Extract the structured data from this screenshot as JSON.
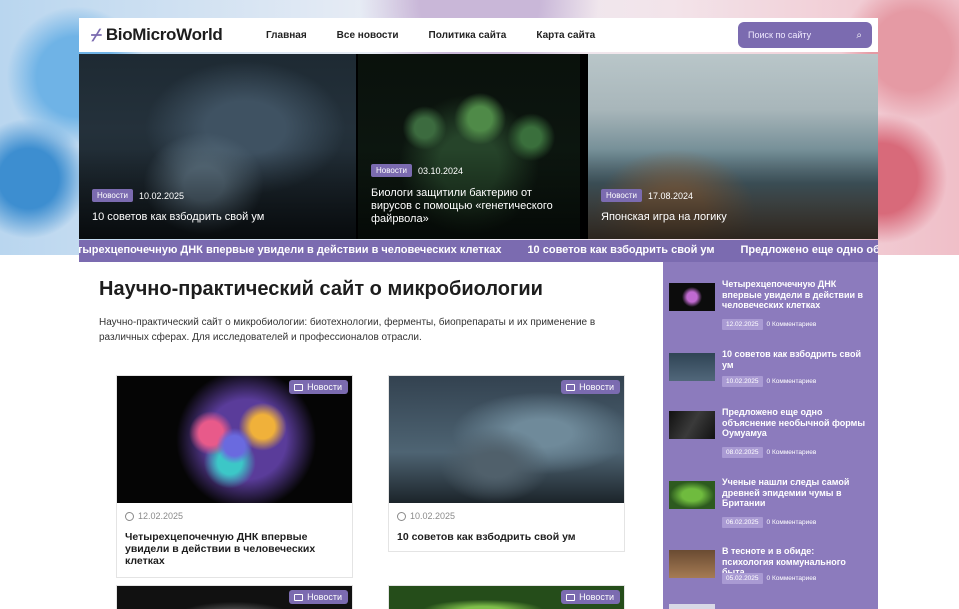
{
  "site": {
    "logo_text": "BioMicroWorld"
  },
  "nav": {
    "items": [
      "Главная",
      "Все новости",
      "Политика сайта",
      "Карта сайта"
    ]
  },
  "search": {
    "placeholder": "Поиск по сайту"
  },
  "hero": {
    "slides": [
      {
        "category": "Новости",
        "date": "10.02.2025",
        "title": "10 советов как взбодрить свой ум"
      },
      {
        "category": "Новости",
        "date": "03.10.2024",
        "title": "Биологи защитили бактерию от вирусов с помощью «генетического файрвола»"
      },
      {
        "category": "Новости",
        "date": "17.08.2024",
        "title": "Японская игра на логику"
      }
    ]
  },
  "ticker": {
    "items": [
      "тырехцепочечную ДНК впервые увидели в действии в человеческих клетках",
      "10 советов как взбодрить свой ум",
      "Предложено еще одно объяснение"
    ]
  },
  "main": {
    "title": "Научно-практический сайт о микробиологии",
    "description": "Научно-практический сайт о микробиологии: биотехнологии, ферменты, биопрепараты и их применение в различных сферах. Для исследователей и профессионалов отрасли.",
    "cards": [
      {
        "category": "Новости",
        "date": "12.02.2025",
        "title": "Четырехцепочечную ДНК впервые увидели в действии в человеческих клетках"
      },
      {
        "category": "Новости",
        "date": "10.02.2025",
        "title": "10 советов как взбодрить свой ум"
      },
      {
        "category": "Новости"
      },
      {
        "category": "Новости"
      }
    ]
  },
  "sidebar": {
    "items": [
      {
        "title": "Четырехцепочечную ДНК впервые увидели в действии в человеческих клетках",
        "date": "12.02.2025",
        "comments": "0 Комментариев"
      },
      {
        "title": "10 советов как взбодрить свой ум",
        "date": "10.02.2025",
        "comments": "0 Комментариев"
      },
      {
        "title": "Предложено еще одно объяснение необычной формы Оумуамуа",
        "date": "08.02.2025",
        "comments": "0 Комментариев"
      },
      {
        "title": "Ученые нашли следы самой древней эпидемии чумы в Британии",
        "date": "06.02.2025",
        "comments": "0 Комментариев"
      },
      {
        "title": "В тесноте и в обиде: психология коммунального быта",
        "date": "05.02.2025",
        "comments": "0 Комментариев"
      }
    ]
  },
  "colors": {
    "accent": "#7b6bb0",
    "sidebar_bg": "#8c7bbd"
  }
}
